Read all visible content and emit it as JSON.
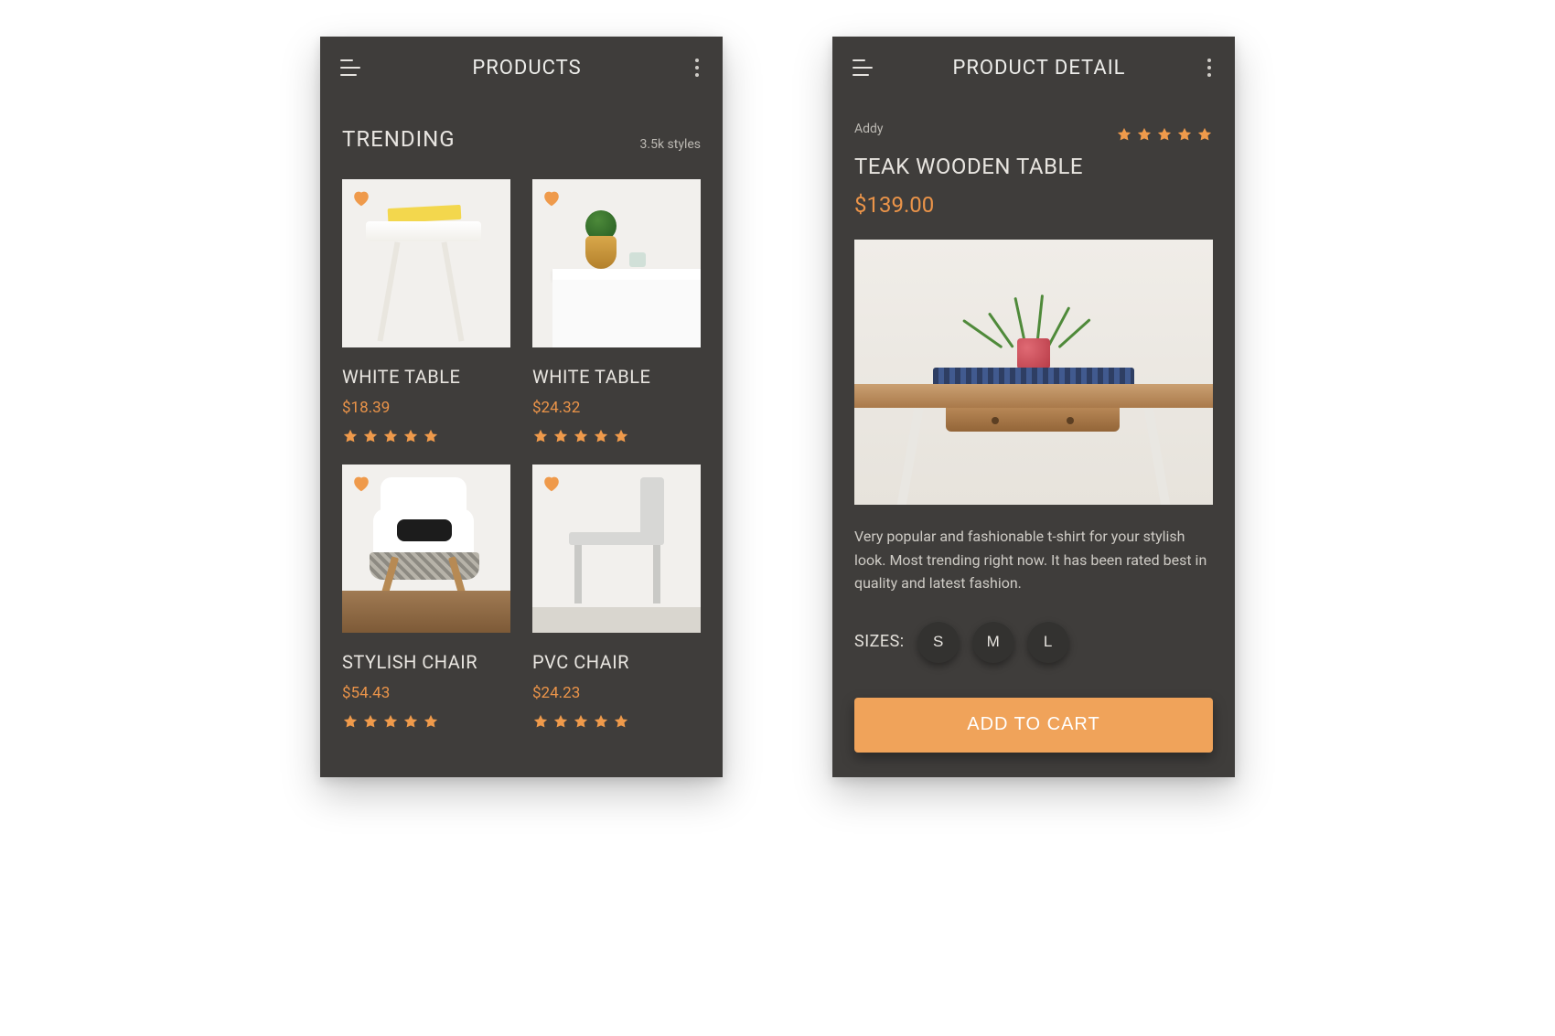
{
  "colors": {
    "accent": "#ef9a4b",
    "card_bg": "#3f3d3b"
  },
  "products_screen": {
    "title": "PRODUCTS",
    "section_title": "TRENDING",
    "section_subtitle": "3.5k styles",
    "items": [
      {
        "name": "WHITE TABLE",
        "price": "$18.39",
        "rating": 5,
        "favorited": true
      },
      {
        "name": "WHITE TABLE",
        "price": "$24.32",
        "rating": 5,
        "favorited": true
      },
      {
        "name": "STYLISH CHAIR",
        "price": "$54.43",
        "rating": 5,
        "favorited": true
      },
      {
        "name": "PVC CHAIR",
        "price": "$24.23",
        "rating": 5,
        "favorited": true
      }
    ]
  },
  "detail_screen": {
    "title": "PRODUCT DETAIL",
    "brand": "Addy",
    "rating": 5,
    "product_name": "TEAK WOODEN TABLE",
    "price": "$139.00",
    "description": "Very popular and fashionable t-shirt for your stylish look. Most trending right now. It has been rated best in quality and latest fashion.",
    "sizes_label": "SIZES:",
    "sizes": [
      "S",
      "M",
      "L"
    ],
    "cta": "ADD TO CART"
  }
}
